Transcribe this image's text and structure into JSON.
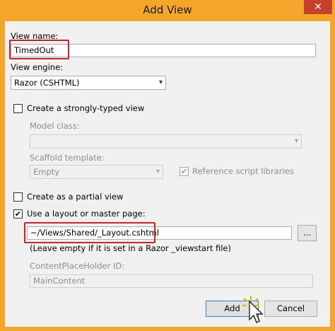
{
  "window": {
    "title": "Add View",
    "close_glyph": "✕"
  },
  "view_name": {
    "label": "View name:",
    "value": "TimedOut"
  },
  "view_engine": {
    "label": "View engine:",
    "selected": "Razor (CSHTML)"
  },
  "strongly_typed": {
    "label": "Create a strongly-typed view",
    "checked": false
  },
  "model_class": {
    "label": "Model class:",
    "value": ""
  },
  "scaffold": {
    "label": "Scaffold template:",
    "selected": "Empty"
  },
  "reference_scripts": {
    "label": "Reference script libraries",
    "checked": true
  },
  "partial_view": {
    "label": "Create as a partial view",
    "checked": false
  },
  "layout": {
    "label": "Use a layout or master page:",
    "checked": true,
    "value": "~/Views/Shared/_Layout.cshtml",
    "browse_label": "...",
    "hint": "(Leave empty if it is set in a Razor _viewstart file)"
  },
  "content_placeholder": {
    "label": "ContentPlaceHolder ID:",
    "value": "MainContent"
  },
  "buttons": {
    "add": "Add",
    "cancel": "Cancel"
  },
  "colors": {
    "accent_border": "#f4a62b",
    "highlight_box": "#c0272d",
    "close_button": "#c7402b"
  },
  "icons": {
    "arrow": "▾",
    "check": "✔"
  }
}
